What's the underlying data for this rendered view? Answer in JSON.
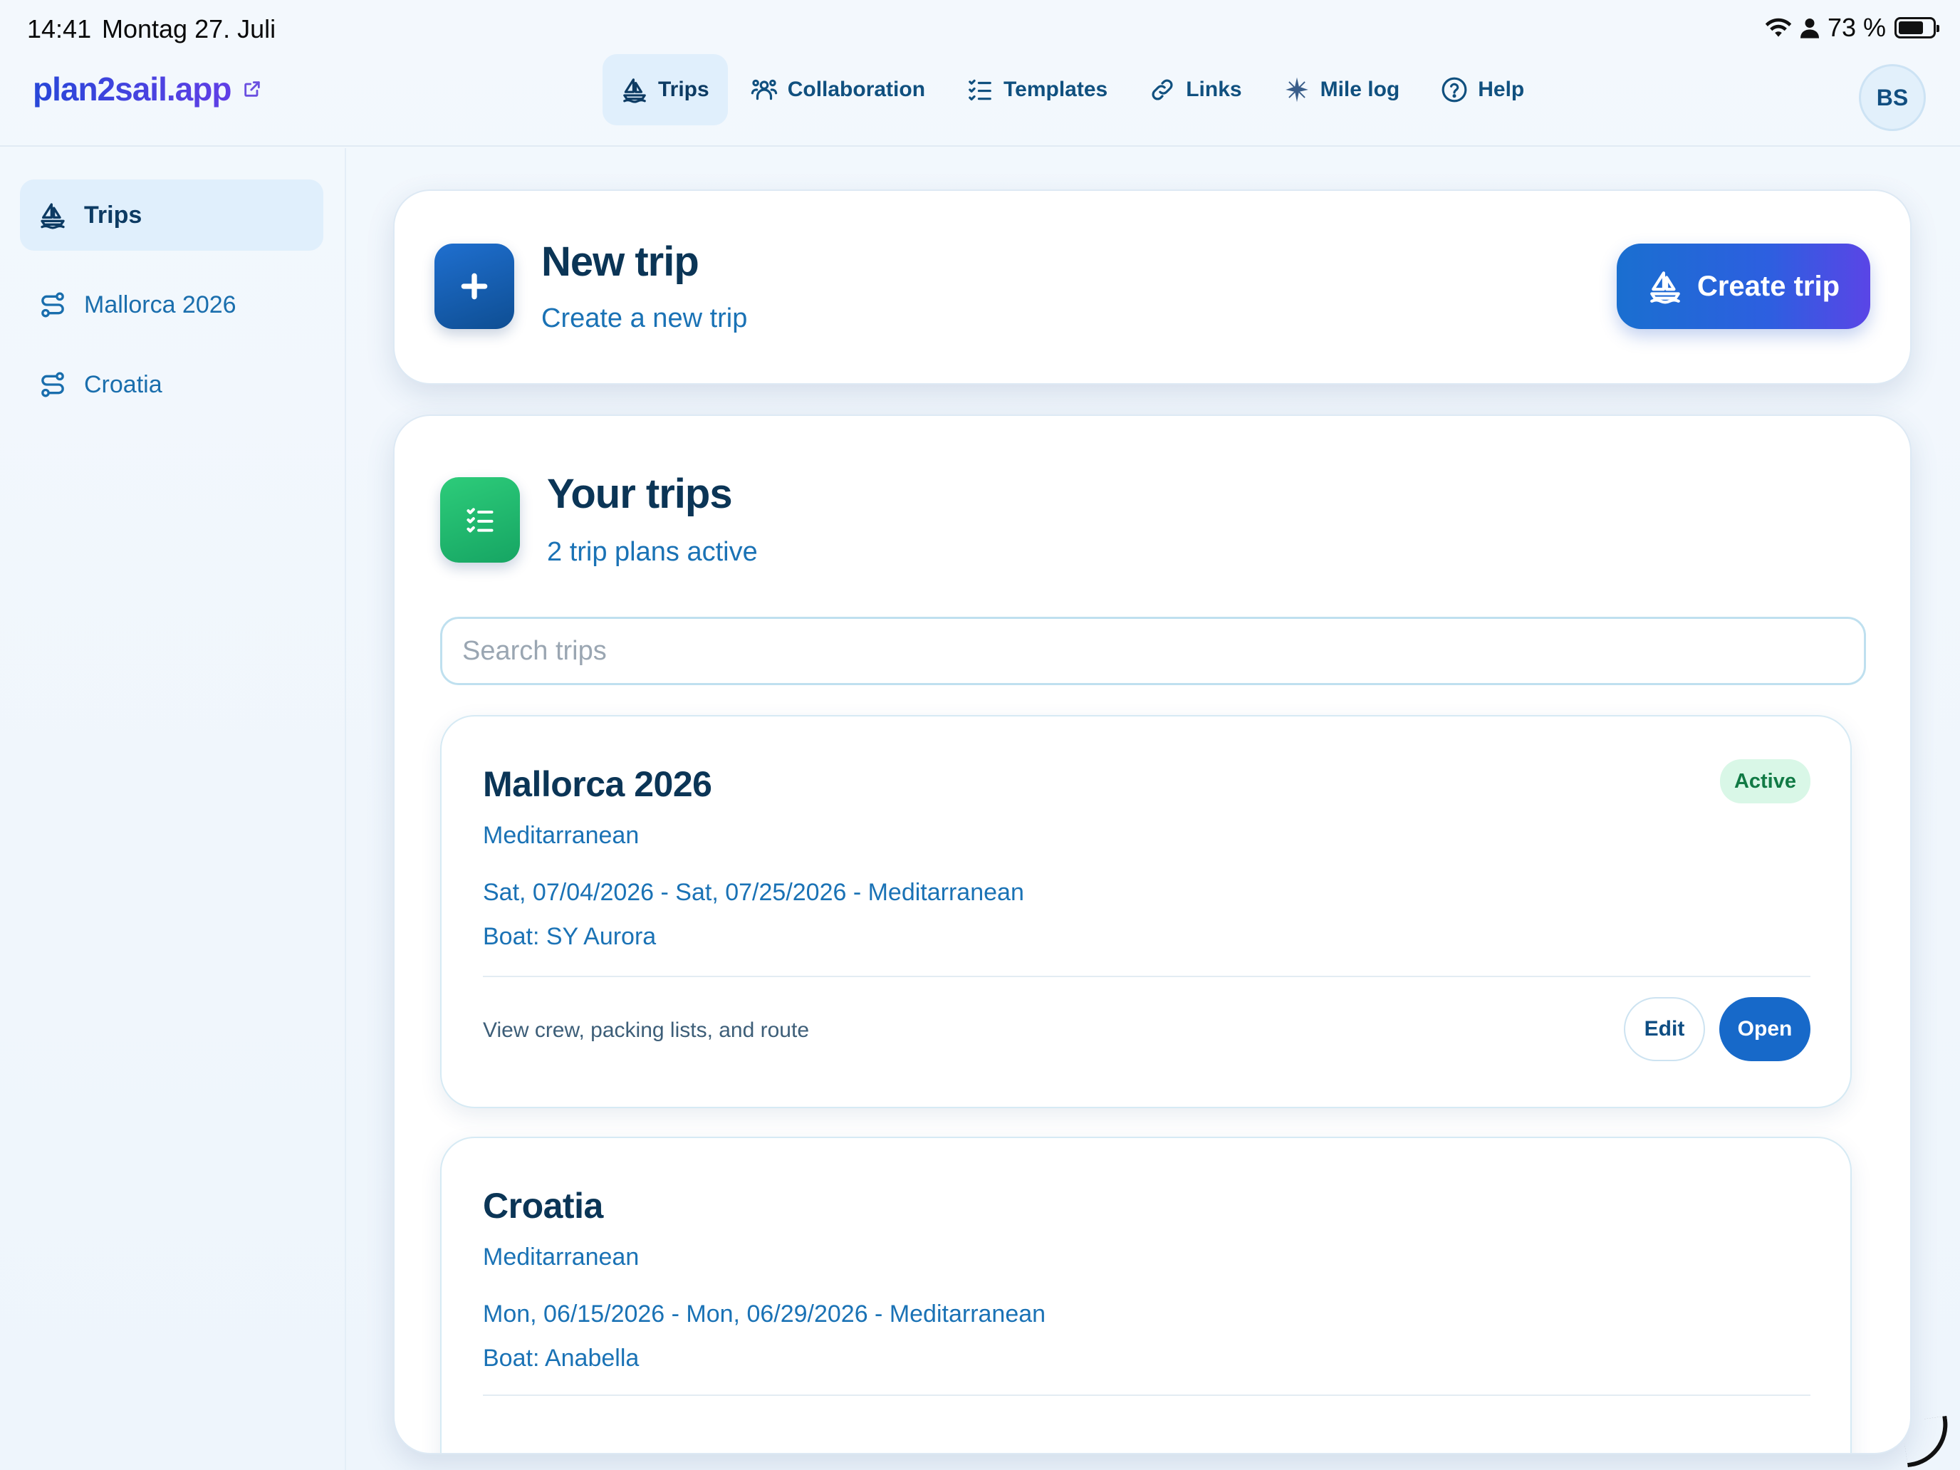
{
  "status_bar": {
    "time": "14:41",
    "date": "Montag 27. Juli",
    "battery_text": "73 %",
    "battery_level": 0.73
  },
  "app": {
    "brand": "plan2sail.app",
    "avatar_initials": "BS",
    "accent_color": "#1769c9"
  },
  "nav": {
    "items": [
      {
        "label": "Trips",
        "icon": "sailboat-icon",
        "active": true
      },
      {
        "label": "Collaboration",
        "icon": "users-icon"
      },
      {
        "label": "Templates",
        "icon": "checklist-icon"
      },
      {
        "label": "Links",
        "icon": "link-icon"
      },
      {
        "label": "Mile log",
        "icon": "compass-star-icon"
      },
      {
        "label": "Help",
        "icon": "help-circle-icon"
      }
    ]
  },
  "sidebar": {
    "items": [
      {
        "label": "Trips",
        "icon": "sailboat-icon"
      },
      {
        "label": "Mallorca 2026",
        "icon": "route-icon"
      },
      {
        "label": "Croatia",
        "icon": "route-icon"
      }
    ]
  },
  "new_trip": {
    "title": "New trip",
    "subtitle": "Create a new trip",
    "button_label": "Create trip"
  },
  "your_trips": {
    "title": "Your trips",
    "subtitle": "2 trip plans active",
    "search_placeholder": "Search trips",
    "trips": [
      {
        "name": "Mallorca 2026",
        "region": "Meditarranean",
        "dates": "Sat, 07/04/2026 - Sat, 07/25/2026 - Meditarranean",
        "boat": "Boat: SY Aurora",
        "status": "Active",
        "hint": "View crew, packing lists, and route",
        "edit_label": "Edit",
        "open_label": "Open"
      },
      {
        "name": "Croatia",
        "region": "Meditarranean",
        "dates": "Mon, 06/15/2026 - Mon, 06/29/2026 - Meditarranean",
        "boat": "Boat: Anabella"
      }
    ]
  }
}
